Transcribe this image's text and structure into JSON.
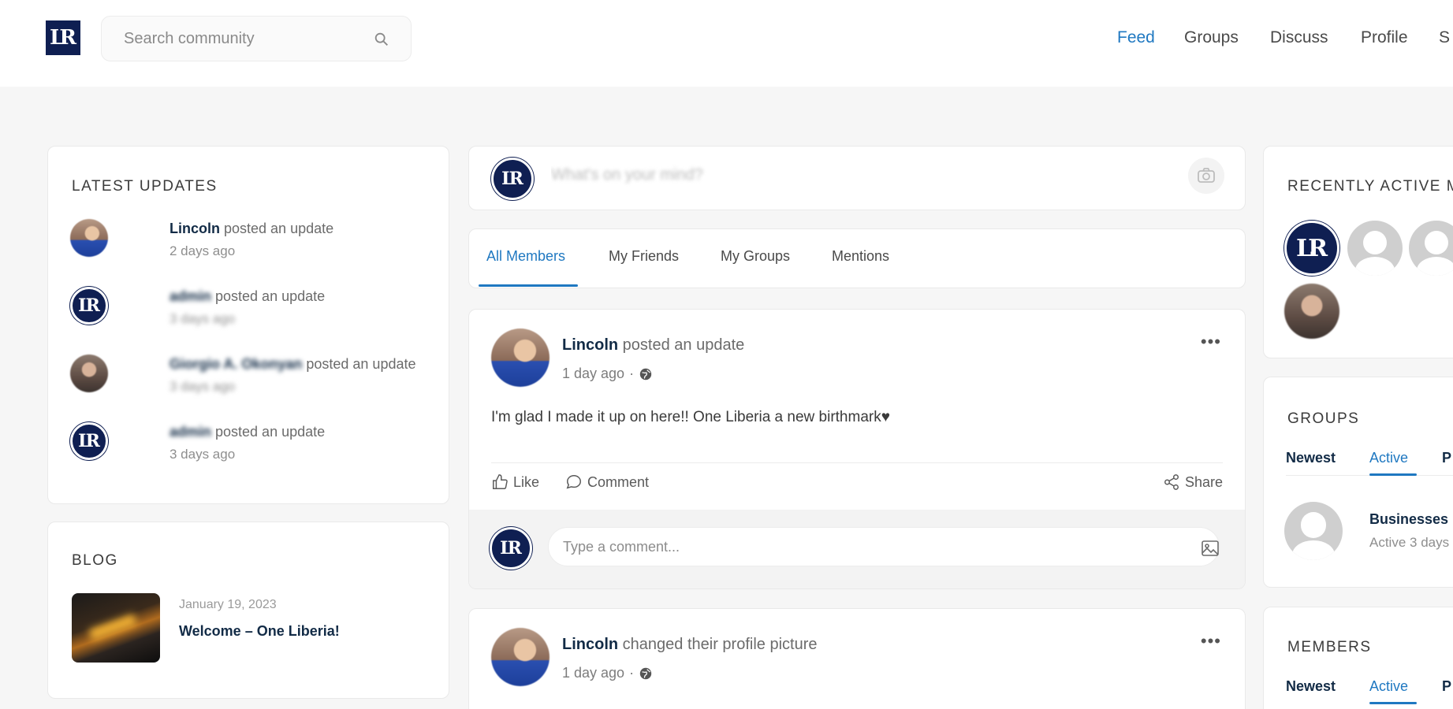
{
  "header": {
    "logo_text": "LR",
    "search_placeholder": "Search community",
    "nav": [
      "Feed",
      "Groups",
      "Discuss",
      "Profile",
      "S"
    ]
  },
  "latest_updates": {
    "title": "LATEST UPDATES",
    "items": [
      {
        "name": "Lincoln",
        "action": " posted an update",
        "time": "2 days ago",
        "blurred": false
      },
      {
        "name": "admin",
        "action": " posted an update",
        "time": "3 days ago",
        "blurred": true
      },
      {
        "name": "Giorgio A. Okonyan",
        "action": " posted an update",
        "time": "3 days ago",
        "blurred": true
      },
      {
        "name": "admin",
        "action": " posted an update",
        "time": "3 days ago",
        "blurred": true
      }
    ]
  },
  "blog": {
    "title": "BLOG",
    "date": "January 19, 2023",
    "post_title": "Welcome – One Liberia!"
  },
  "composer": {
    "placeholder": "What's on your mind?"
  },
  "feed_tabs": [
    "All Members",
    "My Friends",
    "My Groups",
    "Mentions"
  ],
  "posts": [
    {
      "author": "Lincoln",
      "action": " posted an update",
      "time": "1 day ago",
      "separator": "·",
      "body": "I'm glad I made it up on here!! One Liberia a new birthmark♥",
      "like": "Like",
      "comment": "Comment",
      "share": "Share",
      "comment_placeholder": "Type a comment..."
    },
    {
      "author": "Lincoln",
      "action": " changed their profile picture",
      "time": "1 day ago",
      "separator": "·"
    }
  ],
  "right": {
    "recently_active_title": "RECENTLY ACTIVE M",
    "groups": {
      "title": "GROUPS",
      "tabs": [
        "Newest",
        "Active",
        "P"
      ],
      "item_name": "Businesses",
      "item_time": "Active 3 days"
    },
    "members": {
      "title": "MEMBERS",
      "tabs": [
        "Newest",
        "Active",
        "P"
      ]
    }
  },
  "colors": {
    "accent": "#1f78c1",
    "brand_navy": "#0f1f52",
    "background": "#f6f6f6"
  }
}
